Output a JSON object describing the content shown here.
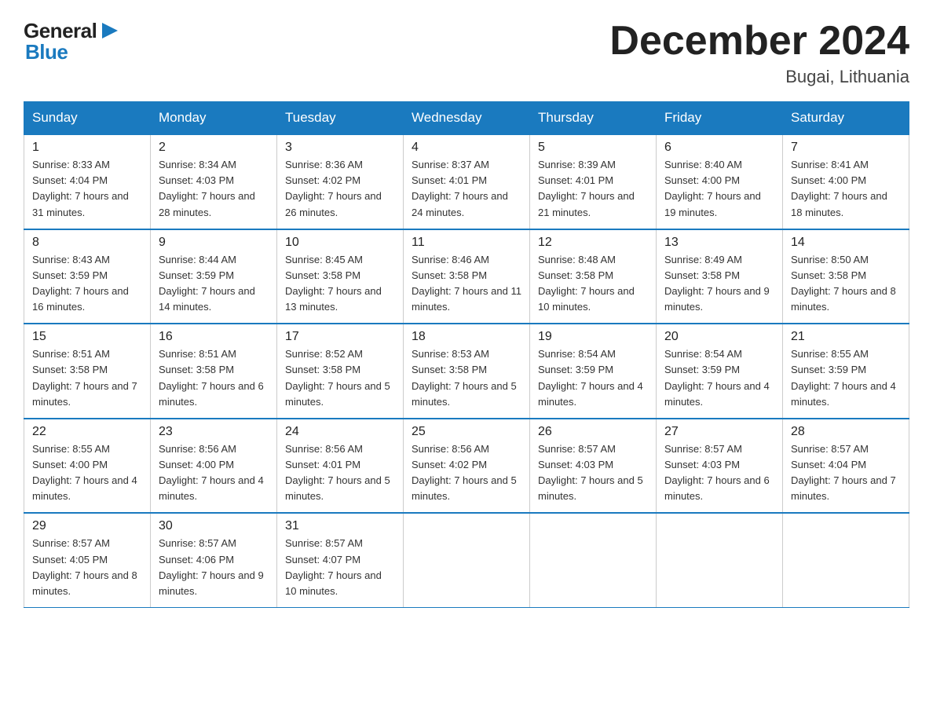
{
  "header": {
    "month_title": "December 2024",
    "location": "Bugai, Lithuania",
    "logo_general": "General",
    "logo_blue": "Blue"
  },
  "days_of_week": [
    "Sunday",
    "Monday",
    "Tuesday",
    "Wednesday",
    "Thursday",
    "Friday",
    "Saturday"
  ],
  "weeks": [
    [
      {
        "day": "1",
        "sunrise": "8:33 AM",
        "sunset": "4:04 PM",
        "daylight": "7 hours and 31 minutes."
      },
      {
        "day": "2",
        "sunrise": "8:34 AM",
        "sunset": "4:03 PM",
        "daylight": "7 hours and 28 minutes."
      },
      {
        "day": "3",
        "sunrise": "8:36 AM",
        "sunset": "4:02 PM",
        "daylight": "7 hours and 26 minutes."
      },
      {
        "day": "4",
        "sunrise": "8:37 AM",
        "sunset": "4:01 PM",
        "daylight": "7 hours and 24 minutes."
      },
      {
        "day": "5",
        "sunrise": "8:39 AM",
        "sunset": "4:01 PM",
        "daylight": "7 hours and 21 minutes."
      },
      {
        "day": "6",
        "sunrise": "8:40 AM",
        "sunset": "4:00 PM",
        "daylight": "7 hours and 19 minutes."
      },
      {
        "day": "7",
        "sunrise": "8:41 AM",
        "sunset": "4:00 PM",
        "daylight": "7 hours and 18 minutes."
      }
    ],
    [
      {
        "day": "8",
        "sunrise": "8:43 AM",
        "sunset": "3:59 PM",
        "daylight": "7 hours and 16 minutes."
      },
      {
        "day": "9",
        "sunrise": "8:44 AM",
        "sunset": "3:59 PM",
        "daylight": "7 hours and 14 minutes."
      },
      {
        "day": "10",
        "sunrise": "8:45 AM",
        "sunset": "3:58 PM",
        "daylight": "7 hours and 13 minutes."
      },
      {
        "day": "11",
        "sunrise": "8:46 AM",
        "sunset": "3:58 PM",
        "daylight": "7 hours and 11 minutes."
      },
      {
        "day": "12",
        "sunrise": "8:48 AM",
        "sunset": "3:58 PM",
        "daylight": "7 hours and 10 minutes."
      },
      {
        "day": "13",
        "sunrise": "8:49 AM",
        "sunset": "3:58 PM",
        "daylight": "7 hours and 9 minutes."
      },
      {
        "day": "14",
        "sunrise": "8:50 AM",
        "sunset": "3:58 PM",
        "daylight": "7 hours and 8 minutes."
      }
    ],
    [
      {
        "day": "15",
        "sunrise": "8:51 AM",
        "sunset": "3:58 PM",
        "daylight": "7 hours and 7 minutes."
      },
      {
        "day": "16",
        "sunrise": "8:51 AM",
        "sunset": "3:58 PM",
        "daylight": "7 hours and 6 minutes."
      },
      {
        "day": "17",
        "sunrise": "8:52 AM",
        "sunset": "3:58 PM",
        "daylight": "7 hours and 5 minutes."
      },
      {
        "day": "18",
        "sunrise": "8:53 AM",
        "sunset": "3:58 PM",
        "daylight": "7 hours and 5 minutes."
      },
      {
        "day": "19",
        "sunrise": "8:54 AM",
        "sunset": "3:59 PM",
        "daylight": "7 hours and 4 minutes."
      },
      {
        "day": "20",
        "sunrise": "8:54 AM",
        "sunset": "3:59 PM",
        "daylight": "7 hours and 4 minutes."
      },
      {
        "day": "21",
        "sunrise": "8:55 AM",
        "sunset": "3:59 PM",
        "daylight": "7 hours and 4 minutes."
      }
    ],
    [
      {
        "day": "22",
        "sunrise": "8:55 AM",
        "sunset": "4:00 PM",
        "daylight": "7 hours and 4 minutes."
      },
      {
        "day": "23",
        "sunrise": "8:56 AM",
        "sunset": "4:00 PM",
        "daylight": "7 hours and 4 minutes."
      },
      {
        "day": "24",
        "sunrise": "8:56 AM",
        "sunset": "4:01 PM",
        "daylight": "7 hours and 5 minutes."
      },
      {
        "day": "25",
        "sunrise": "8:56 AM",
        "sunset": "4:02 PM",
        "daylight": "7 hours and 5 minutes."
      },
      {
        "day": "26",
        "sunrise": "8:57 AM",
        "sunset": "4:03 PM",
        "daylight": "7 hours and 5 minutes."
      },
      {
        "day": "27",
        "sunrise": "8:57 AM",
        "sunset": "4:03 PM",
        "daylight": "7 hours and 6 minutes."
      },
      {
        "day": "28",
        "sunrise": "8:57 AM",
        "sunset": "4:04 PM",
        "daylight": "7 hours and 7 minutes."
      }
    ],
    [
      {
        "day": "29",
        "sunrise": "8:57 AM",
        "sunset": "4:05 PM",
        "daylight": "7 hours and 8 minutes."
      },
      {
        "day": "30",
        "sunrise": "8:57 AM",
        "sunset": "4:06 PM",
        "daylight": "7 hours and 9 minutes."
      },
      {
        "day": "31",
        "sunrise": "8:57 AM",
        "sunset": "4:07 PM",
        "daylight": "7 hours and 10 minutes."
      },
      null,
      null,
      null,
      null
    ]
  ]
}
